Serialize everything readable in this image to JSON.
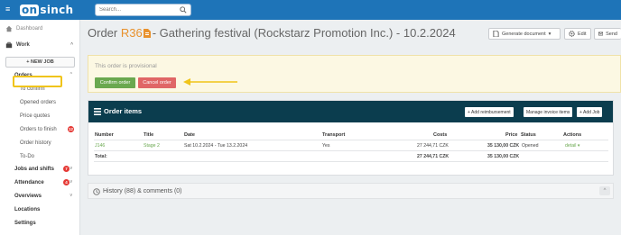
{
  "topbar": {
    "logo_on": "on",
    "logo_rest": "sinch",
    "search_placeholder": "Search..."
  },
  "sidebar": {
    "dashboard": "Dashboard",
    "work": "Work",
    "new_job": "+ NEW JOB",
    "orders": "Orders",
    "order_items": [
      {
        "label": "To confirm"
      },
      {
        "label": "Opened orders"
      },
      {
        "label": "Price quotes"
      },
      {
        "label": "Orders to finish",
        "badge": "12"
      },
      {
        "label": "Order history"
      },
      {
        "label": "To-Do"
      }
    ],
    "jobs_and_shifts": "Jobs and shifts",
    "jobs_badge": "7",
    "attendance": "Attendance",
    "attendance_badge": "4",
    "overviews": "Overviews",
    "locations": "Locations",
    "settings": "Settings"
  },
  "order": {
    "prefix": "Order",
    "number": "R36",
    "rest": "- Gathering festival (Rockstarz Promotion Inc.) - 10.2.2024"
  },
  "toolbar": {
    "generate": "Generate document",
    "edit": "Edit",
    "send": "Send"
  },
  "provisional": {
    "message": "This order is provisional",
    "confirm": "Confirm order",
    "cancel": "Cancel order"
  },
  "items_panel": {
    "title": "Order items",
    "add_reimbursement": "+ Add reimbursement",
    "manage_invoice": "Manage invoice items",
    "add_job": "+ Add Job",
    "columns": [
      "Number",
      "Title",
      "Date",
      "Transport",
      "Costs",
      "Price",
      "Status",
      "Actions"
    ],
    "row": {
      "number": "J146",
      "title": "Stage 2",
      "date": "Sat 10.2.2024 - Tue 13.2.2024",
      "transport": "Yes",
      "costs": "27 244,71 CZK",
      "price": "35 130,00 CZK",
      "status": "Opened",
      "action": "detail"
    },
    "total": {
      "label": "Total:",
      "costs": "27 244,71 CZK",
      "price": "35 130,00 CZK"
    }
  },
  "history": {
    "title": "History (88) & comments (0)"
  },
  "colors": {
    "topbar": "#1e74b8",
    "accent_orange": "#e8912c",
    "confirm_green": "#6aa84f",
    "cancel_red": "#e06666",
    "panel_head": "#0b3d4e",
    "highlight": "#f0c419"
  }
}
